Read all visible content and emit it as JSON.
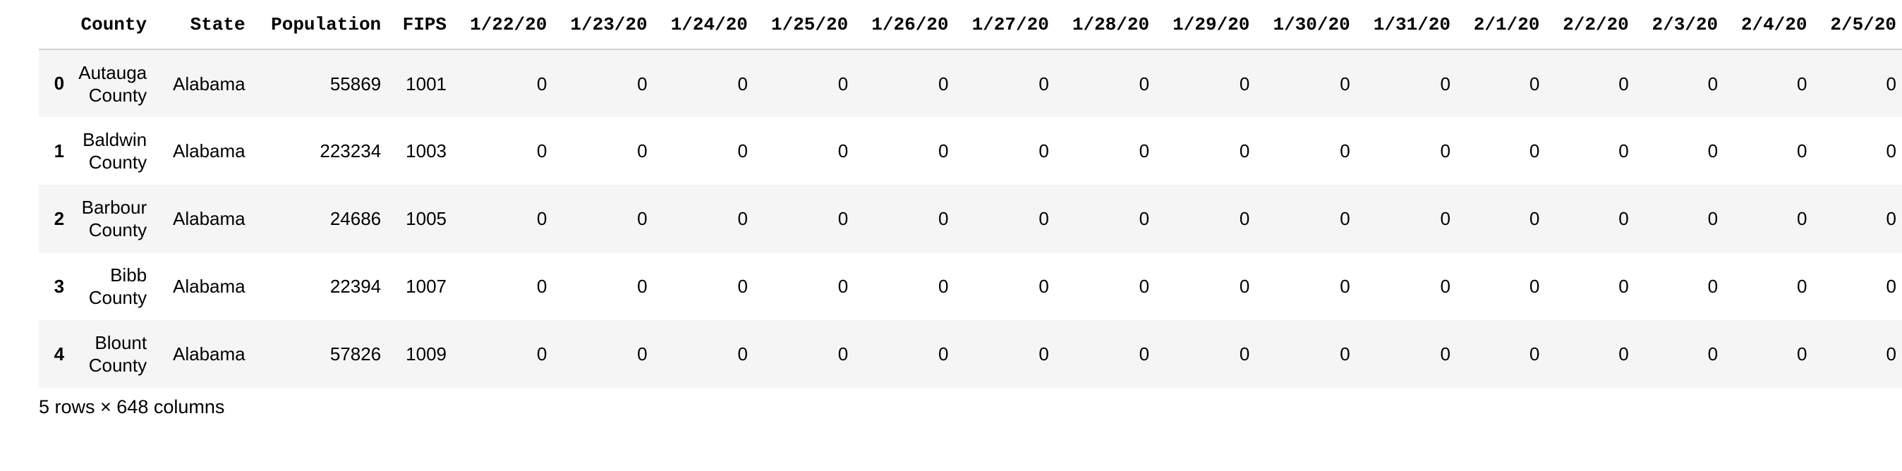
{
  "table": {
    "columns": [
      "County",
      "State",
      "Population",
      "FIPS",
      "1/22/20",
      "1/23/20",
      "1/24/20",
      "1/25/20",
      "1/26/20",
      "1/27/20",
      "1/28/20",
      "1/29/20",
      "1/30/20",
      "1/31/20",
      "2/1/20",
      "2/2/20",
      "2/3/20",
      "2/4/20",
      "2/5/20"
    ],
    "rows": [
      {
        "index": "0",
        "cells": [
          "Autauga County",
          "Alabama",
          "55869",
          "1001",
          "0",
          "0",
          "0",
          "0",
          "0",
          "0",
          "0",
          "0",
          "0",
          "0",
          "0",
          "0",
          "0",
          "0",
          "0"
        ]
      },
      {
        "index": "1",
        "cells": [
          "Baldwin County",
          "Alabama",
          "223234",
          "1003",
          "0",
          "0",
          "0",
          "0",
          "0",
          "0",
          "0",
          "0",
          "0",
          "0",
          "0",
          "0",
          "0",
          "0",
          "0"
        ]
      },
      {
        "index": "2",
        "cells": [
          "Barbour County",
          "Alabama",
          "24686",
          "1005",
          "0",
          "0",
          "0",
          "0",
          "0",
          "0",
          "0",
          "0",
          "0",
          "0",
          "0",
          "0",
          "0",
          "0",
          "0"
        ]
      },
      {
        "index": "3",
        "cells": [
          "Bibb County",
          "Alabama",
          "22394",
          "1007",
          "0",
          "0",
          "0",
          "0",
          "0",
          "0",
          "0",
          "0",
          "0",
          "0",
          "0",
          "0",
          "0",
          "0",
          "0"
        ]
      },
      {
        "index": "4",
        "cells": [
          "Blount County",
          "Alabama",
          "57826",
          "1009",
          "0",
          "0",
          "0",
          "0",
          "0",
          "0",
          "0",
          "0",
          "0",
          "0",
          "0",
          "0",
          "0",
          "0",
          "0"
        ]
      }
    ]
  },
  "footer": {
    "shape_text": "5 rows × 648 columns"
  }
}
